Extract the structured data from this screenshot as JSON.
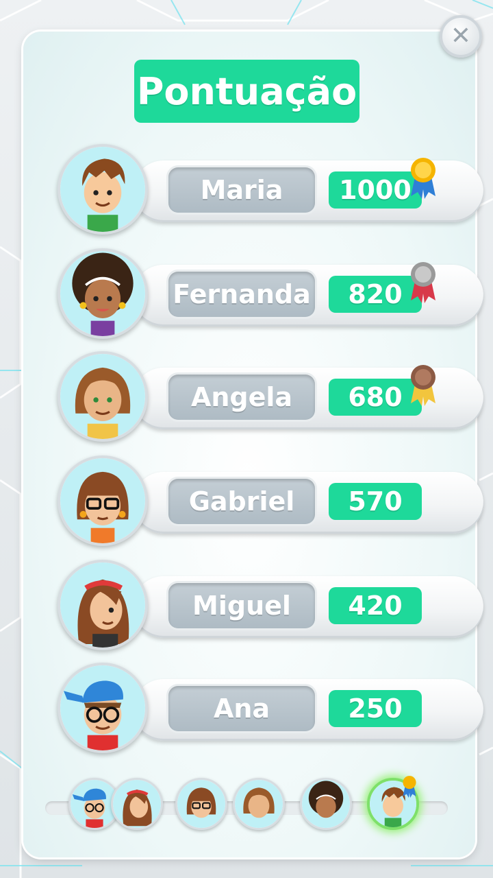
{
  "title": "Pontuação",
  "close_icon": "close-icon",
  "colors": {
    "accent_green": "#1ed99a",
    "name_plate": "#b4c1ca",
    "gold": "#f5b400",
    "silver": "#a9a9a9",
    "bronze": "#a0705a"
  },
  "players": [
    {
      "name": "Maria",
      "score": "1000",
      "medal": "gold-medal-icon",
      "avatar": "boy-brown-hair-avatar"
    },
    {
      "name": "Fernanda",
      "score": "820",
      "medal": "silver-medal-icon",
      "avatar": "girl-curly-hair-avatar"
    },
    {
      "name": "Angela",
      "score": "680",
      "medal": "bronze-medal-icon",
      "avatar": "long-hair-avatar"
    },
    {
      "name": "Gabriel",
      "score": "570",
      "medal": "",
      "avatar": "glasses-bangs-avatar"
    },
    {
      "name": "Miguel",
      "score": "420",
      "medal": "",
      "avatar": "headband-girl-avatar"
    },
    {
      "name": "Ana",
      "score": "250",
      "medal": "",
      "avatar": "cap-glasses-boy-avatar"
    }
  ],
  "progress_track": {
    "markers": [
      "cap-glasses-boy-avatar",
      "headband-girl-avatar",
      "glasses-bangs-avatar",
      "long-hair-avatar",
      "girl-curly-hair-avatar",
      "boy-brown-hair-avatar"
    ],
    "active": "boy-brown-hair-avatar"
  }
}
